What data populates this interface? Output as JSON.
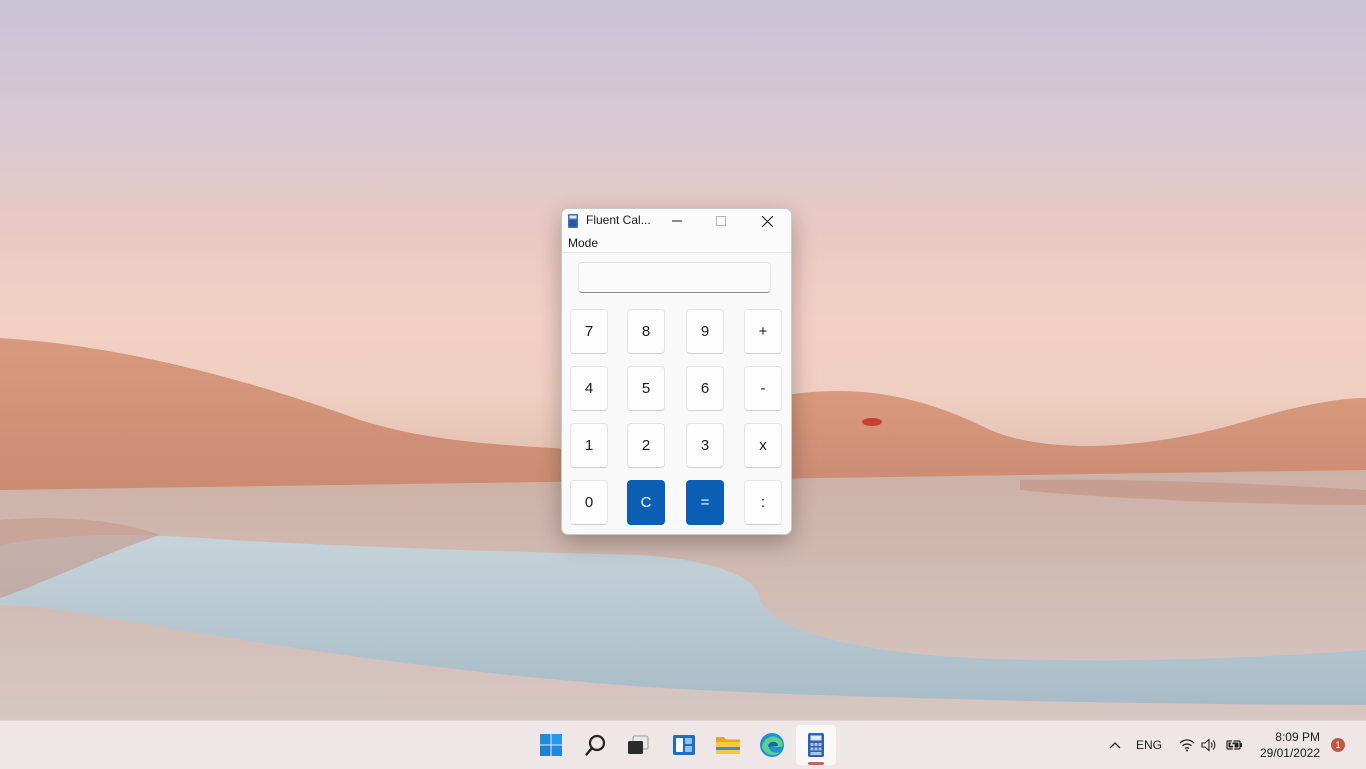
{
  "window": {
    "title": "Fluent Cal...",
    "menu": [
      "Mode"
    ],
    "display_value": ""
  },
  "keypad": [
    [
      "7",
      "8",
      "9",
      "+"
    ],
    [
      "4",
      "5",
      "6",
      "-"
    ],
    [
      "1",
      "2",
      "3",
      "x"
    ],
    [
      "0",
      "C",
      "=",
      ":"
    ]
  ],
  "accent_color": "#0a5fb4",
  "taskbar": {
    "apps": [
      "windows-start",
      "search",
      "task-view",
      "widgets",
      "file-explorer",
      "edge",
      "fluent-calculator"
    ],
    "active_app": "fluent-calculator",
    "language": "ENG",
    "time": "8:09 PM",
    "date": "29/01/2022",
    "notification_count": "1"
  }
}
